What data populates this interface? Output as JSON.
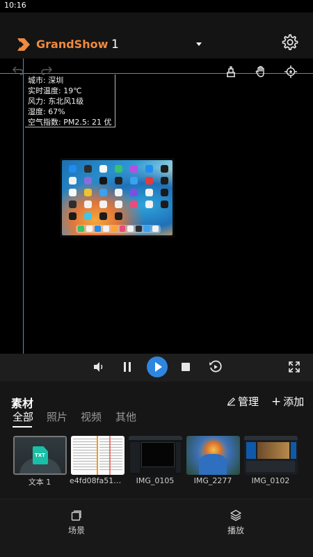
{
  "status_bar": {
    "time": "10:16"
  },
  "header": {
    "brand": "GrandShow",
    "scene_number": "1"
  },
  "weather_widget": {
    "city": "城市: 深圳",
    "temperature": "实时温度: 19℃",
    "wind": "风力: 东北风1级",
    "humidity": "湿度: 67%",
    "air_quality": "空气指数: PM2.5: 21 优"
  },
  "assets": {
    "title": "素材",
    "manage_label": "管理",
    "add_label": "添加",
    "tabs": [
      {
        "label": "全部",
        "active": true
      },
      {
        "label": "照片",
        "active": false
      },
      {
        "label": "视频",
        "active": false
      },
      {
        "label": "其他",
        "active": false
      }
    ],
    "items": [
      {
        "label": "文本 1",
        "type": "text",
        "badge": "TXT",
        "selected": true
      },
      {
        "label": "e4fd08fa513...",
        "type": "image",
        "selected": false
      },
      {
        "label": "IMG_0105",
        "type": "image",
        "selected": false
      },
      {
        "label": "IMG_2277",
        "type": "image",
        "selected": false
      },
      {
        "label": "IMG_0102",
        "type": "image",
        "selected": false
      }
    ]
  },
  "bottom_nav": {
    "scene_label": "场景",
    "play_label": "播放"
  },
  "colors": {
    "brand": "#f08a3e",
    "accent": "#2e86de",
    "guide_line": "#4c8dd6"
  }
}
